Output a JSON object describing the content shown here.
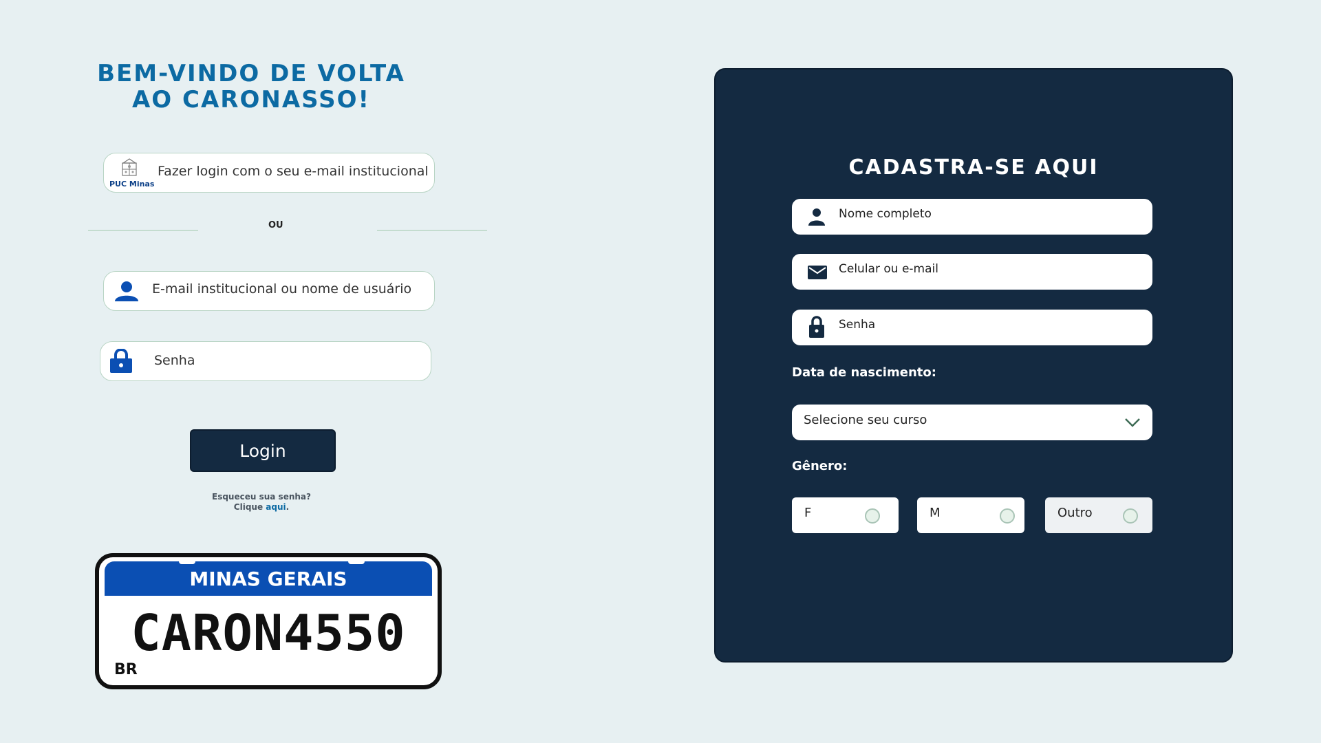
{
  "welcome": {
    "line1": "BEM-VINDO DE VOLTA",
    "line2": "AO CARONASSO!"
  },
  "login": {
    "puc_button_label": "Fazer login com o seu e-mail institucional",
    "puc_logo_text": "PUC Minas",
    "divider_text": "OU",
    "user_placeholder": "E-mail institucional ou nome de usuário",
    "password_placeholder": "Senha",
    "login_button": "Login",
    "forgot_line1": "Esqueceu sua senha?",
    "forgot_line2_prefix": "Clique ",
    "forgot_link": "aqui",
    "forgot_line2_suffix": "."
  },
  "plate": {
    "state": "MINAS GERAIS",
    "number": "CARON4550",
    "country": "BR"
  },
  "register": {
    "title": "CADASTRA-SE AQUI",
    "name_placeholder": "Nome completo",
    "contact_placeholder": "Celular ou e-mail",
    "password_placeholder": "Senha",
    "dob_label": "Data de nascimento:",
    "course_select": "Selecione seu curso",
    "gender_label": "Gênero:",
    "gender_options": [
      "F",
      "M",
      "Outro"
    ]
  },
  "colors": {
    "background": "#e7f0f2",
    "accent_blue": "#0c6aa3",
    "panel_navy": "#142a41",
    "icon_blue": "#0b4fb3"
  },
  "icons": [
    "puc-minas-crest-icon",
    "user-icon",
    "lock-icon",
    "mail-icon",
    "chevron-down-icon"
  ]
}
